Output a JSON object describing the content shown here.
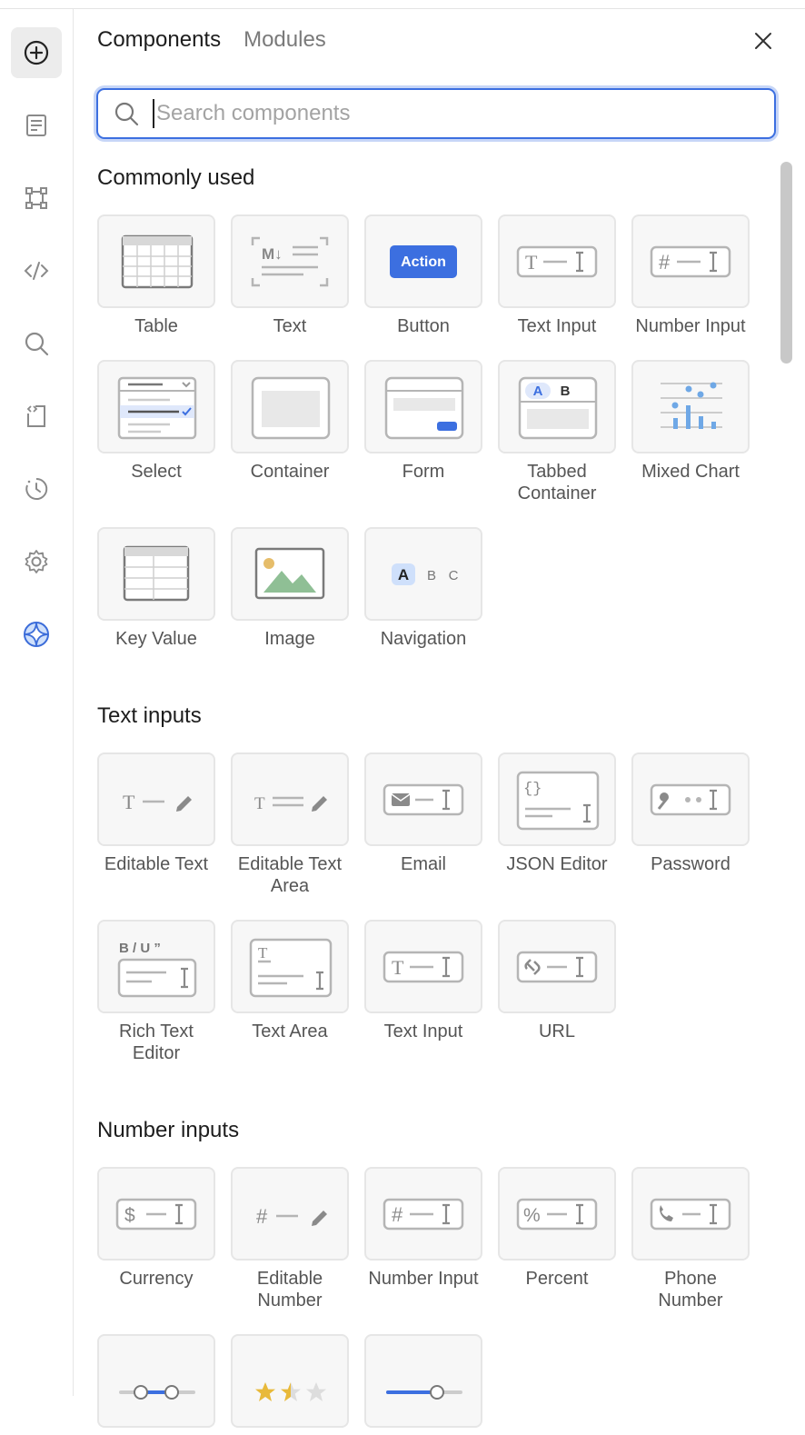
{
  "rail": {
    "items": [
      {
        "name": "add-icon",
        "active": true
      },
      {
        "name": "document-icon"
      },
      {
        "name": "frame-icon"
      },
      {
        "name": "code-icon"
      },
      {
        "name": "search-icon"
      },
      {
        "name": "code-file-icon"
      },
      {
        "name": "history-icon"
      },
      {
        "name": "settings-icon"
      },
      {
        "name": "ai-sparkle-icon"
      }
    ]
  },
  "panel": {
    "tabs": [
      {
        "label": "Components",
        "active": true
      },
      {
        "label": "Modules",
        "active": false
      }
    ],
    "search": {
      "placeholder": "Search components",
      "value": ""
    }
  },
  "sections": [
    {
      "title": "Commonly used",
      "items": [
        {
          "label": "Table",
          "icon": "table"
        },
        {
          "label": "Text",
          "icon": "text"
        },
        {
          "label": "Button",
          "icon": "button",
          "badge": "Action"
        },
        {
          "label": "Text Input",
          "icon": "text-input"
        },
        {
          "label": "Number Input",
          "icon": "number-input"
        },
        {
          "label": "Select",
          "icon": "select"
        },
        {
          "label": "Container",
          "icon": "container"
        },
        {
          "label": "Form",
          "icon": "form"
        },
        {
          "label": "Tabbed\nContainer",
          "icon": "tabbed-container",
          "tabs": [
            "A",
            "B"
          ]
        },
        {
          "label": "Mixed Chart",
          "icon": "mixed-chart"
        },
        {
          "label": "Key Value",
          "icon": "key-value"
        },
        {
          "label": "Image",
          "icon": "image"
        },
        {
          "label": "Navigation",
          "icon": "navigation",
          "letters": [
            "A",
            "B",
            "C"
          ]
        }
      ]
    },
    {
      "title": "Text inputs",
      "items": [
        {
          "label": "Editable Text",
          "icon": "editable-text"
        },
        {
          "label": "Editable Text\nArea",
          "icon": "editable-text-area"
        },
        {
          "label": "Email",
          "icon": "email"
        },
        {
          "label": "JSON Editor",
          "icon": "json-editor"
        },
        {
          "label": "Password",
          "icon": "password"
        },
        {
          "label": "Rich Text\nEditor",
          "icon": "rich-text-editor",
          "glyphs": "B / U ”"
        },
        {
          "label": "Text Area",
          "icon": "text-area"
        },
        {
          "label": "Text Input",
          "icon": "text-input"
        },
        {
          "label": "URL",
          "icon": "url"
        }
      ]
    },
    {
      "title": "Number inputs",
      "items": [
        {
          "label": "Currency",
          "icon": "currency"
        },
        {
          "label": "Editable\nNumber",
          "icon": "editable-number"
        },
        {
          "label": "Number Input",
          "icon": "number-input"
        },
        {
          "label": "Percent",
          "icon": "percent"
        },
        {
          "label": "Phone\nNumber",
          "icon": "phone-number"
        },
        {
          "label": "",
          "icon": "range-slider"
        },
        {
          "label": "",
          "icon": "rating"
        },
        {
          "label": "",
          "icon": "slider"
        }
      ]
    }
  ],
  "colors": {
    "accent": "#3c6fe0",
    "accent_soft": "#c7d6f7",
    "icon_gray": "#8a8a8a",
    "tile_bg": "#f7f7f7"
  }
}
